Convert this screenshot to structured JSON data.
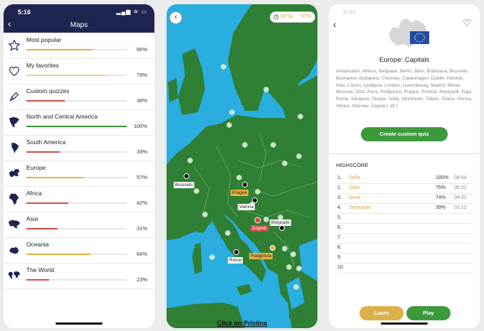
{
  "colors": {
    "navy": "#1e2551",
    "gold": "#e5b13e",
    "red": "#d64b43",
    "green": "#3c9a3c",
    "sea": "#29aedf",
    "land": "#2f7f35"
  },
  "screen1": {
    "time": "5:16",
    "status": "▂▄▆ ≋ ▭",
    "back_icon": "‹",
    "title": "Maps",
    "rows": [
      {
        "label": "Most popular",
        "value": 66,
        "pct": "66%",
        "color": "#e5b13e",
        "icon": "star-icon"
      },
      {
        "label": "My favorites",
        "value": 79,
        "pct": "79%",
        "color": "#f3d36d",
        "icon": "heart-icon"
      },
      {
        "label": "Custom quizzes",
        "value": 38,
        "pct": "38%",
        "color": "#d64b43",
        "icon": "pen-icon"
      },
      {
        "label": "North and Central America",
        "value": 100,
        "pct": "100%",
        "color": "#3c9a3c",
        "icon": "north-america-icon"
      },
      {
        "label": "South America",
        "value": 33,
        "pct": "33%",
        "color": "#d64b43",
        "icon": "south-america-icon"
      },
      {
        "label": "Europe",
        "value": 57,
        "pct": "57%",
        "color": "#e5b13e",
        "icon": "europe-icon"
      },
      {
        "label": "Africa",
        "value": 42,
        "pct": "42%",
        "color": "#d64b43",
        "icon": "africa-icon"
      },
      {
        "label": "Asia",
        "value": 31,
        "pct": "31%",
        "color": "#d64b43",
        "icon": "asia-icon"
      },
      {
        "label": "Oceania",
        "value": 64,
        "pct": "64%",
        "color": "#e5b13e",
        "icon": "oceania-icon"
      },
      {
        "label": "The World",
        "value": 23,
        "pct": "23%",
        "color": "#d64b43",
        "icon": "world-icon"
      }
    ]
  },
  "screen2": {
    "back_icon": "‹",
    "timer": "00:54",
    "percent": "57%",
    "timer_icon": "clock-icon",
    "cities": [
      {
        "name": "Brussels",
        "style": "w"
      },
      {
        "name": "Prague",
        "style": "y"
      },
      {
        "name": "Vienna",
        "style": "w"
      },
      {
        "name": "Zagreb",
        "style": "r"
      },
      {
        "name": "Belgrade",
        "style": "w"
      },
      {
        "name": "Podgorica",
        "style": "y"
      },
      {
        "name": "Rome",
        "style": "w"
      }
    ],
    "prompt": "Click on Pristina"
  },
  "screen3": {
    "time": "9:49",
    "back_icon": "‹",
    "heart_icon": "♡",
    "title": "Europe: Capitals",
    "description": "Amsterdam, Athens, Belgrade, Berlin, Bern, Bratislava, Brussels, Bucharest, Budapest, Chisinau, Copenhagen, Dublin, Helsinki, Kiev, Lisbon, Ljubljana, London, Luxembourg, Madrid, Minsk, Moscow, Oslo, Paris, Podgorica, Prague, Pristina, Reykjavik, Riga, Rome, Sarajevo, Skopje, Sofia, Stockholm, Tallinn, Tirana, Vienna, Vilnius, Warsaw, Zagreb ( 39 )",
    "create_button": "Create custom quiz",
    "highscore_title": "HIGHSCORE",
    "scores": [
      {
        "rank": "1.",
        "name": "Sofia",
        "pct": "100%",
        "time": "04:54"
      },
      {
        "rank": "2.",
        "name": "John",
        "pct": "75%",
        "time": "05:02"
      },
      {
        "rank": "3.",
        "name": "Anna",
        "pct": "74%",
        "time": "04:31"
      },
      {
        "rank": "4.",
        "name": "Sebastian",
        "pct": "39%",
        "time": "02:12"
      },
      {
        "rank": "5.",
        "name": "",
        "pct": "",
        "time": ""
      },
      {
        "rank": "6.",
        "name": "",
        "pct": "",
        "time": ""
      },
      {
        "rank": "7.",
        "name": "",
        "pct": "",
        "time": ""
      },
      {
        "rank": "8.",
        "name": "",
        "pct": "",
        "time": ""
      },
      {
        "rank": "9.",
        "name": "",
        "pct": "",
        "time": ""
      },
      {
        "rank": "10.",
        "name": "",
        "pct": "",
        "time": ""
      }
    ],
    "learn_button": "Learn",
    "play_button": "Play"
  }
}
